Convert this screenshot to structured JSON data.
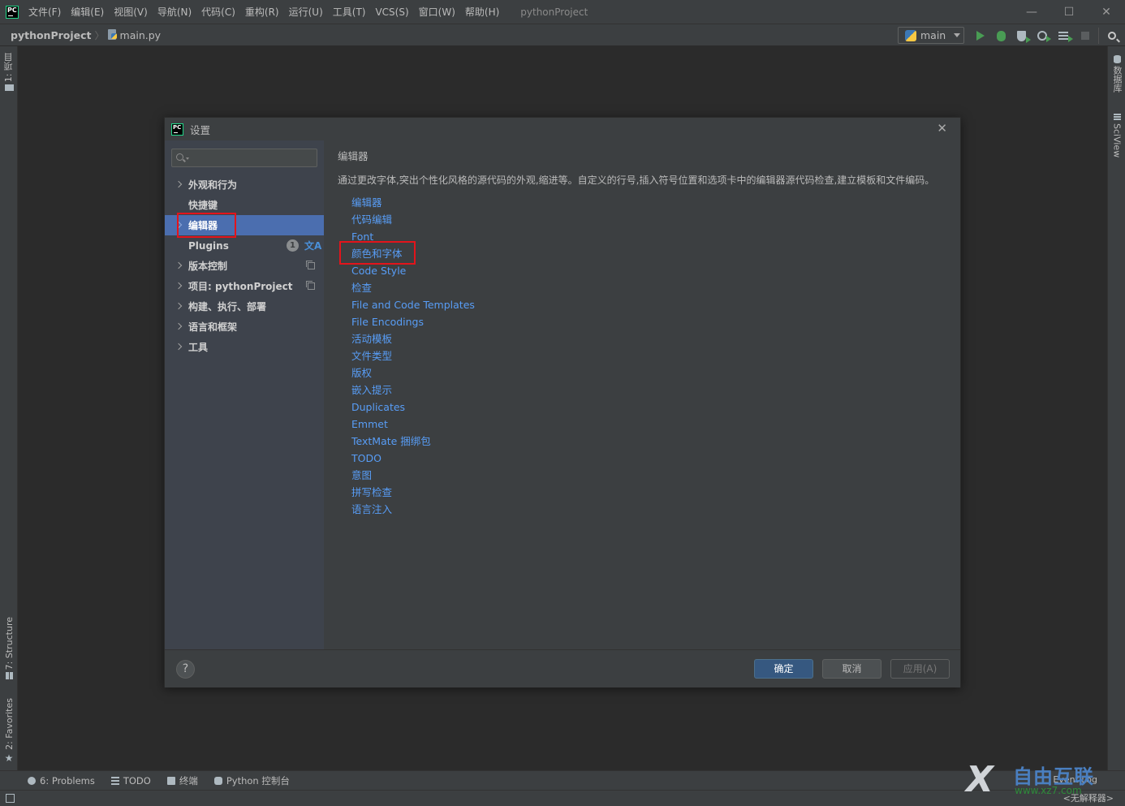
{
  "menubar": {
    "logo": "PC",
    "items": [
      "文件(F)",
      "编辑(E)",
      "视图(V)",
      "导航(N)",
      "代码(C)",
      "重构(R)",
      "运行(U)",
      "工具(T)",
      "VCS(S)",
      "窗口(W)",
      "帮助(H)"
    ],
    "window_title": "pythonProject",
    "controls": {
      "minimize": "—",
      "maximize": "☐",
      "close": "✕"
    }
  },
  "navbar": {
    "project": "pythonProject",
    "separator": "〉",
    "file": "main.py",
    "run_config": "main"
  },
  "left_strip": {
    "top_tab": "1: 项目",
    "structure_tab": "7: Structure",
    "favorites_tab": "2: Favorites"
  },
  "right_strip": {
    "database_tab": "数据库",
    "sciview_tab": "SciView"
  },
  "dialog": {
    "logo": "PC",
    "title": "设置",
    "close": "✕",
    "search_placeholder": "",
    "tree": [
      {
        "label": "外观和行为",
        "expandable": true
      },
      {
        "label": "快捷键",
        "expandable": false
      },
      {
        "label": "编辑器",
        "expandable": true,
        "selected": true
      },
      {
        "label": "Plugins",
        "expandable": false,
        "badge": "1",
        "translate_icon": "文A"
      },
      {
        "label": "版本控制",
        "expandable": true,
        "copy_icon": true
      },
      {
        "label": "项目: pythonProject",
        "expandable": true,
        "copy_icon": true
      },
      {
        "label": "构建、执行、部署",
        "expandable": true
      },
      {
        "label": "语言和框架",
        "expandable": true
      },
      {
        "label": "工具",
        "expandable": true
      }
    ],
    "content": {
      "title": "编辑器",
      "description": "通过更改字体,突出个性化风格的源代码的外观,缩进等。自定义的行号,插入符号位置和选项卡中的编辑器源代码检查,建立模板和文件编码。",
      "links": [
        "编辑器",
        "代码编辑",
        "Font",
        "颜色和字体",
        "Code Style",
        "检查",
        "File and Code Templates",
        "File Encodings",
        "活动模板",
        "文件类型",
        "版权",
        "嵌入提示",
        "Duplicates",
        "Emmet",
        "TextMate 捆绑包",
        "TODO",
        "意图",
        "拼写检查",
        "语言注入"
      ],
      "highlighted_link": "颜色和字体"
    },
    "footer": {
      "help": "?",
      "ok": "确定",
      "cancel": "取消",
      "apply": "应用(A)"
    }
  },
  "bottom_bar": {
    "tabs": [
      "6: Problems",
      "TODO",
      "终端",
      "Python 控制台"
    ],
    "event_log": "Event Log",
    "interpreter": "<无解释器>"
  },
  "watermark": {
    "mark": "X",
    "text": "自由互联",
    "url": "www.xz7.com"
  },
  "colors": {
    "accent_selection": "#4b6eaf",
    "link": "#589df6",
    "primary_button": "#365880",
    "highlight_box": "#e3141b",
    "run_green": "#499c54"
  }
}
